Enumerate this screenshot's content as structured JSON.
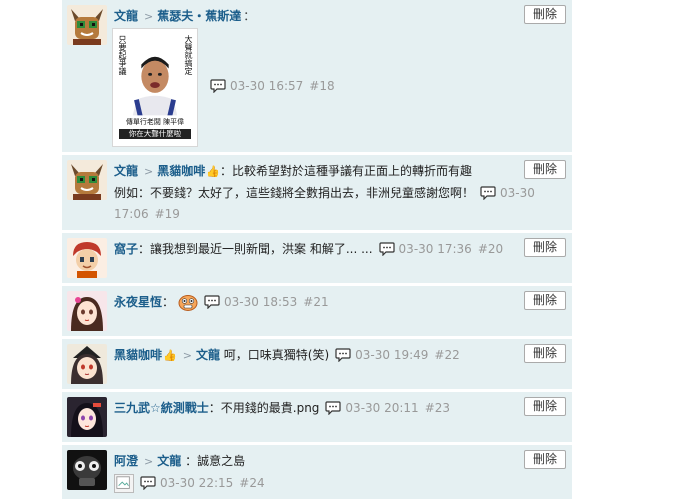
{
  "delete_label": "刪除",
  "comments": [
    {
      "user": "文龍",
      "reply_to": "蕉瑟夫・蕉斯達",
      "text": "：",
      "image_caption_lines": [
        "大聲就搞定",
        "只要起爭議",
        "傳單行老闆 陳平偉",
        "你在大聲什麼啦"
      ],
      "time": "03-30 16:57",
      "num": "#18"
    },
    {
      "user": "文龍",
      "reply_to": "黑貓咖啡",
      "text_line1": "：比較希望對於這種爭議有正面上的轉折而有趣",
      "text_line2": "例如：不要錢？太好了，這些錢將全數捐出去，非洲兒童感謝您啊！",
      "time_a": "03-30",
      "time_b": "17:06",
      "num": "#19"
    },
    {
      "user": "窩子",
      "text": "：讓我想到最近一則新聞，洪案 和解了... ...",
      "time": "03-30 17:36",
      "num": "#20"
    },
    {
      "user": "永夜星恆",
      "text": "：",
      "time": "03-30 18:53",
      "num": "#21"
    },
    {
      "user": "黑貓咖啡",
      "reply_to": "文龍",
      "text": "呵，口味真獨特(笑)",
      "time": "03-30 19:49",
      "num": "#22"
    },
    {
      "user": "三九武☆統測戰士",
      "text": "：不用錢的最貴.png",
      "time": "03-30 20:11",
      "num": "#23"
    },
    {
      "user": "阿澄",
      "reply_to": "文龍",
      "text": "：誠意之島",
      "time": "03-30 22:15",
      "num": "#24"
    }
  ],
  "colors": {
    "card_bg": "#e5f0f2",
    "username": "#1c5e8b",
    "meta": "#999999"
  }
}
